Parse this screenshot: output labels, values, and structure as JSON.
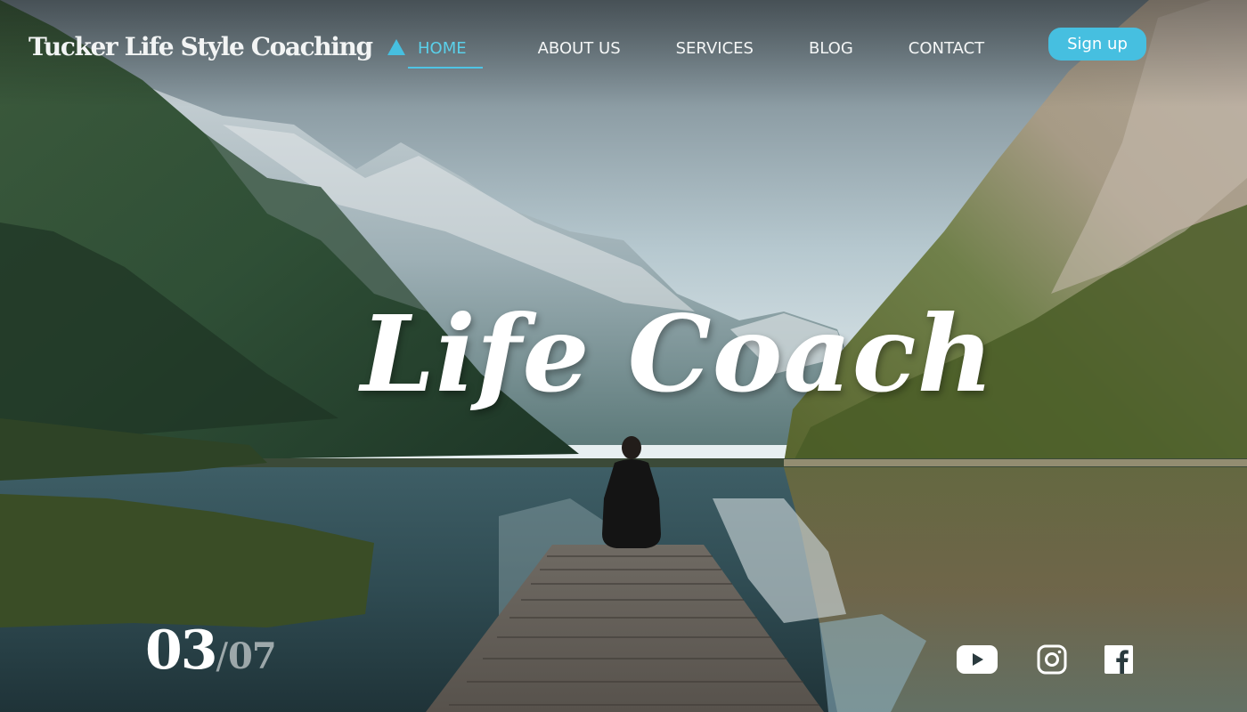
{
  "brand": {
    "name": "Tucker Life Style Coaching",
    "logo_icon": "triangle-logo-icon",
    "accent_color": "#46bfe0"
  },
  "nav": {
    "items": [
      {
        "label": "HOME",
        "active": true
      },
      {
        "label": "ABOUT US",
        "active": false
      },
      {
        "label": "SERVICES",
        "active": false
      },
      {
        "label": "BLOG",
        "active": false
      },
      {
        "label": "CONTACT",
        "active": false
      }
    ]
  },
  "header": {
    "signup_label": "Sign up"
  },
  "hero": {
    "title": "Life Coach"
  },
  "slider": {
    "current": "03",
    "separator": "/",
    "total": "07"
  },
  "social": {
    "items": [
      {
        "icon": "youtube-icon"
      },
      {
        "icon": "instagram-icon"
      },
      {
        "icon": "facebook-icon"
      }
    ]
  }
}
